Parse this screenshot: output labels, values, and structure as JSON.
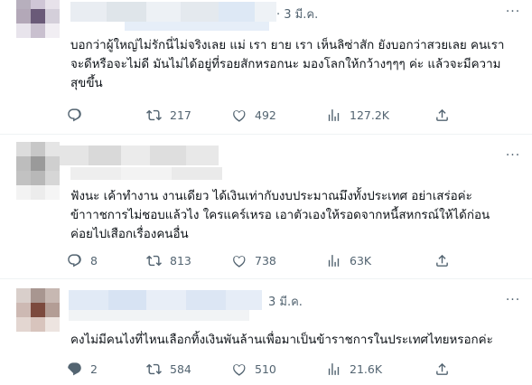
{
  "tweets": [
    {
      "date": "· 3 มี.ค.",
      "text": "บอกว่าผู้ใหญ่ไม่รักนี่ไม่จริงเลย แม่ เรา ยาย เรา เห็นลิซ่าสัก ยังบอกว่าสวยเลย คนเราจะดีหรือจะไม่ดี มันไม่ได้อยู่ที่รอยสักหรอกนะ มองโลกให้กว้างๆๆๆ ค่ะ แล้วจะมีความสุขขึ้น",
      "replies": "",
      "retweets": "217",
      "likes": "492",
      "views": "127.2K"
    },
    {
      "date": "",
      "text": "ฟังนะ เค้าทำงาน งานเดียว ได้เงินเท่ากับงบประมาณมึงทั้งประเทศ อย่าเสร่อค่ะ\nข้าาาชการไม่ชอบแล้วไง ใครแคร์เหรอ เอาตัวเองให้รอดจากหนี้สหกรณ์ให้ได้ก่อน\nค่อยไปเสือกเรื่องคนอื่น",
      "replies": "8",
      "retweets": "813",
      "likes": "738",
      "views": "63K"
    },
    {
      "date": "3 มี.ค.",
      "text": "คงไม่มีคนไงที่ไหนเลือกทิ้งเงินพันล้านเพื่อมาเป็นข้าราชการในประเทศไทยหรอกค่ะ",
      "replies": "2",
      "retweets": "584",
      "likes": "510",
      "views": "21.6K"
    }
  ],
  "icons": {
    "reply": "reply-icon",
    "retweet": "retweet-icon",
    "like": "heart-icon",
    "views": "views-icon",
    "share": "share-icon",
    "more": "more-icon"
  },
  "colors": {
    "text": "#0f1419",
    "muted": "#536471",
    "divider": "#eff3f4"
  }
}
